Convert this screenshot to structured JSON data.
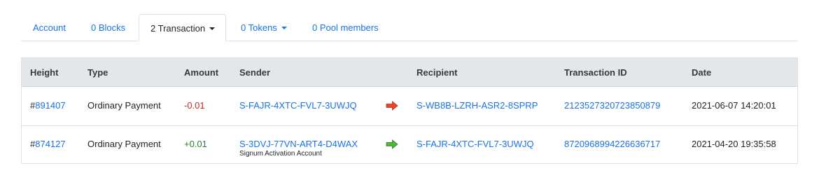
{
  "tabs": [
    {
      "label": "Account"
    },
    {
      "label": "0 Blocks"
    },
    {
      "label": "2 Transaction"
    },
    {
      "label": "0 Tokens"
    },
    {
      "label": "0 Pool members"
    }
  ],
  "table": {
    "headers": {
      "height": "Height",
      "type": "Type",
      "amount": "Amount",
      "sender": "Sender",
      "recipient": "Recipient",
      "txid": "Transaction ID",
      "date": "Date"
    },
    "rows": [
      {
        "height_prefix": "#",
        "height": "891407",
        "type": "Ordinary Payment",
        "amount": "-0.01",
        "sender": "S-FAJR-4XTC-FVL7-3UWJQ",
        "sender_name": "",
        "direction": "out",
        "recipient": "S-WB8B-LZRH-ASR2-8SPRP",
        "txid": "2123527320723850879",
        "date": "2021-06-07 14:20:01"
      },
      {
        "height_prefix": "#",
        "height": "874127",
        "type": "Ordinary Payment",
        "amount": "+0.01",
        "sender": "S-3DVJ-77VN-ART4-D4WAX",
        "sender_name": "Signum Activation Account",
        "direction": "in",
        "recipient": "S-FAJR-4XTC-FVL7-3UWJQ",
        "txid": "8720968994226636717",
        "date": "2021-04-20 19:35:58"
      }
    ]
  },
  "colors": {
    "link": "#1a73e8",
    "negative": "#c62828",
    "positive": "#2e7d32",
    "arrow_out": "#e8472b",
    "arrow_in": "#4fb83a",
    "header_bg": "#e4e7ea"
  },
  "icons": {
    "out": "arrow-right-red-icon",
    "in": "arrow-right-green-icon"
  }
}
